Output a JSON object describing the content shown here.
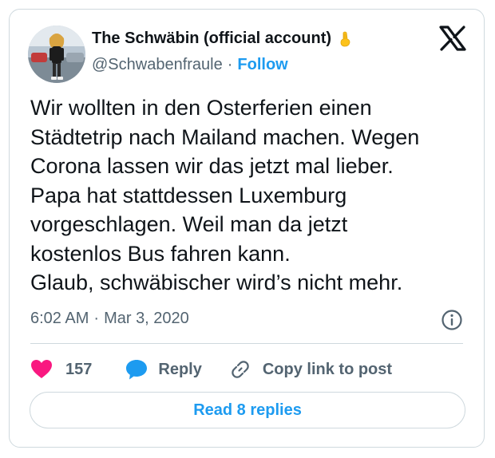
{
  "author": {
    "display_name": "The Schwäbin (official account)",
    "handle": "@Schwabenfraule",
    "follow_label": "Follow",
    "avatar": "avatar-photo",
    "badge_emoji": "pinched-fingers-emoji"
  },
  "tweet": {
    "text": "Wir wollten in den Osterferien einen\nStädtetrip nach Mailand machen. Wegen\nCorona lassen wir das jetzt mal lieber.\nPapa hat stattdessen Luxemburg\nvorgeschlagen. Weil man da jetzt\nkostenlos Bus fahren kann.\nGlaub, schwäbischer wird’s nicht mehr.",
    "time": "6:02 AM",
    "date": "Mar 3, 2020"
  },
  "actions": {
    "like_count": "157",
    "reply_label": "Reply",
    "copy_link_label": "Copy link to post"
  },
  "read_replies_label": "Read 8 replies",
  "icons": {
    "platform": "x-logo-icon",
    "info": "info-icon",
    "like": "heart-icon",
    "reply": "speech-bubble-icon",
    "copy": "link-icon"
  },
  "colors": {
    "accent": "#1d9bf0",
    "like": "#f91880",
    "text": "#0f1419",
    "secondary": "#536471",
    "border": "#cfd9de"
  }
}
